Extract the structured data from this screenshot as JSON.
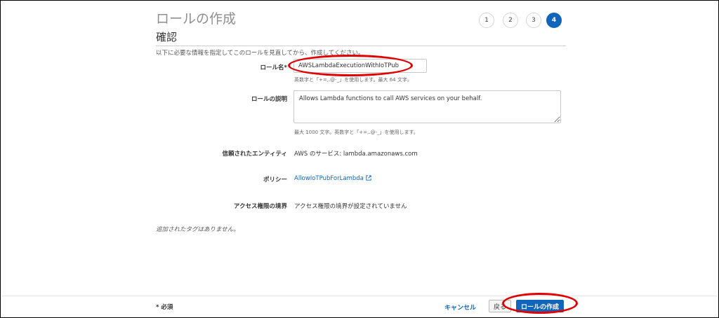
{
  "header": {
    "title": "ロールの作成",
    "steps": [
      "1",
      "2",
      "3",
      "4"
    ],
    "active_step": 4
  },
  "section": {
    "title": "確認",
    "intro": "以下に必要な情報を指定してこのロールを見直してから、作成してください。"
  },
  "form": {
    "role_name": {
      "label": "ロール名*",
      "value": "AWSLambdaExecutionWithIoTPub",
      "hint": "英数字と「+=,.@-_」を使用します。最大 64 文字。"
    },
    "role_description": {
      "label": "ロールの説明",
      "value": "Allows Lambda functions to call AWS services on your behalf.",
      "hint": "最大 1000 文字。英数字と「+=,.@-_」を使用します。"
    },
    "trusted_entity": {
      "label": "信頼されたエンティティ",
      "value": "AWS のサービス: lambda.amazonaws.com"
    },
    "policy": {
      "label": "ポリシー",
      "value": "AllowIoTPubForLambda",
      "icon": "external-link-icon"
    },
    "permissions_boundary": {
      "label": "アクセス権限の境界",
      "value": "アクセス権限の境界が設定されていません"
    }
  },
  "tags_note": "追加されたタグはありません。",
  "footer": {
    "required_note": "* 必須",
    "cancel_label": "キャンセル",
    "back_label": "戻る",
    "create_label": "ロールの作成"
  },
  "colors": {
    "accent": "#1166bb",
    "highlight": "#e00000"
  }
}
